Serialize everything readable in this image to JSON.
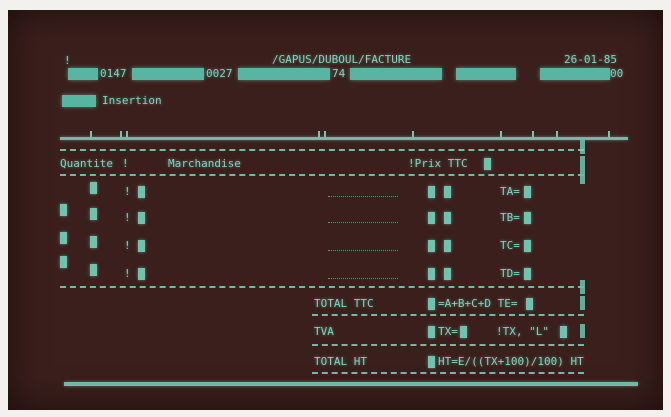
{
  "header": {
    "path": "/GAPUS/DUBOUL/FACTURE",
    "date": "26-01-85",
    "leading_char": "!",
    "field_a": "0147",
    "field_b": "0027",
    "field_c": "74",
    "field_d": "00"
  },
  "mode": {
    "label": "Insertion"
  },
  "columns": {
    "quantite": "Quantite",
    "sep1": "!",
    "marchandise": "Marchandise",
    "prix": "!Prix TTC"
  },
  "rows": [
    {
      "sep": "!",
      "tax": "TA="
    },
    {
      "sep": "!",
      "tax": "TB="
    },
    {
      "sep": "!",
      "tax": "TC="
    },
    {
      "sep": "!",
      "tax": "TD="
    }
  ],
  "totals": {
    "ttc_label": "TOTAL TTC",
    "ttc_formula": "=A+B+C+D TE=",
    "tva_label": "TVA",
    "tva_formula": "TX=",
    "tva_extra": "!TX, \"L\"",
    "ht_label": "TOTAL HT",
    "ht_formula": "HT=E/((TX+100)/100) HT"
  }
}
